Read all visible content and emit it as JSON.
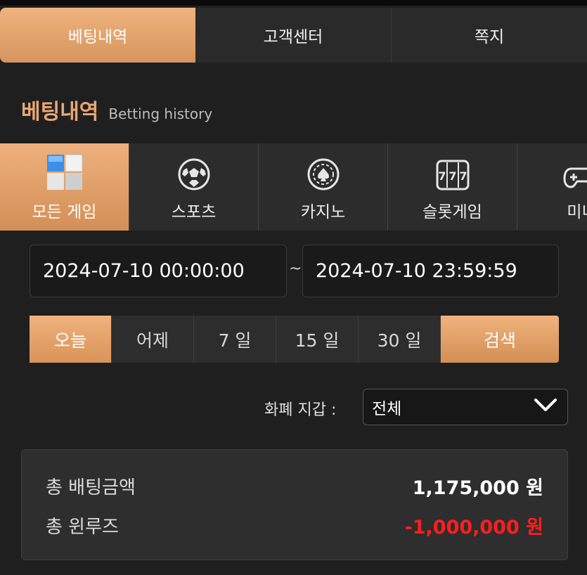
{
  "top_tabs": [
    {
      "label": "베팅내역"
    },
    {
      "label": "고객센터"
    },
    {
      "label": "쪽지"
    }
  ],
  "section": {
    "title_ko": "베팅내역",
    "title_en": "Betting history"
  },
  "game_tabs": [
    {
      "label": "모든 게임",
      "icon": "cube-grid-icon"
    },
    {
      "label": "스포츠",
      "icon": "soccer-ball-icon"
    },
    {
      "label": "카지노",
      "icon": "casino-chip-icon"
    },
    {
      "label": "슬롯게임",
      "icon": "slot-777-icon"
    },
    {
      "label": "미니",
      "icon": "gamepad-icon"
    }
  ],
  "date_range": {
    "start": "2024-07-10 00:00:00",
    "separator": "~",
    "end": "2024-07-10 23:59:59"
  },
  "periods": [
    {
      "label": "오늘"
    },
    {
      "label": "어제"
    },
    {
      "label": "7 일"
    },
    {
      "label": "15 일"
    },
    {
      "label": "30 일"
    }
  ],
  "search_label": "검색",
  "wallet": {
    "label": "화폐 지갑 :",
    "selected": "전체"
  },
  "summary": {
    "total_bet_label": "총 배팅금액",
    "total_bet_value": "1,175,000 원",
    "total_winloss_label": "총 윈루즈",
    "total_winloss_value": "-1,000,000 원"
  },
  "colors": {
    "accent": "#e8a772",
    "negative": "#ff1e1e",
    "background": "#1f1f1f"
  }
}
